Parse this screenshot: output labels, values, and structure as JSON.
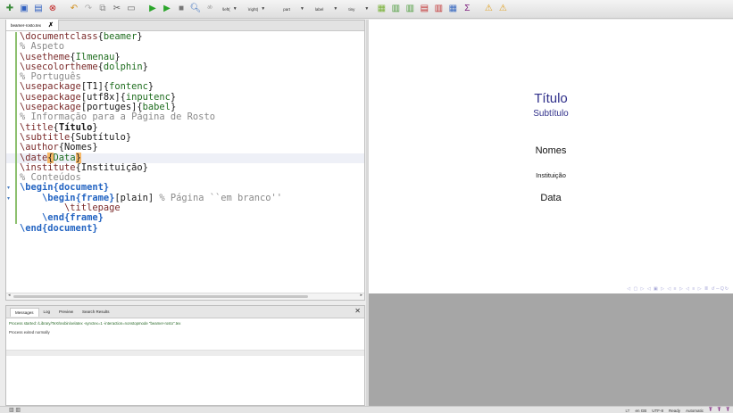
{
  "toolbar": {
    "combos": [
      {
        "label": "\\left(",
        "name": "left-delim-combo"
      },
      {
        "label": "\\right)",
        "name": "right-delim-combo"
      },
      {
        "label": "part",
        "name": "structure-combo"
      },
      {
        "label": "label",
        "name": "label-combo"
      },
      {
        "label": "tiny",
        "name": "size-combo"
      }
    ]
  },
  "editor": {
    "tab_label": "beamer-rosto.tex",
    "tab_close": "✗"
  },
  "messages": {
    "tabs": [
      "Messages",
      "Log",
      "Preview",
      "Search Results"
    ],
    "close": "✕",
    "line1": "Process started: /Library/TeX/texbin/xelatex -synctex=1 -interaction=nonstopmode \"beamer-rosto\".tex",
    "line2": "Process exited normally"
  },
  "preview": {
    "title": "Título",
    "subtitle": "Subtítulo",
    "author": "Nomes",
    "institute": "Instituição",
    "date": "Data",
    "nav": "◁ ▢ ▷ ◁ ▣ ▷ ◁ ≡ ▷ ◁ ≡ ▷ ≣ ↺∽Q↻"
  },
  "status": {
    "language": "en GB",
    "encoding": "UTF-8",
    "state": "Ready",
    "mode": "Automatic"
  }
}
